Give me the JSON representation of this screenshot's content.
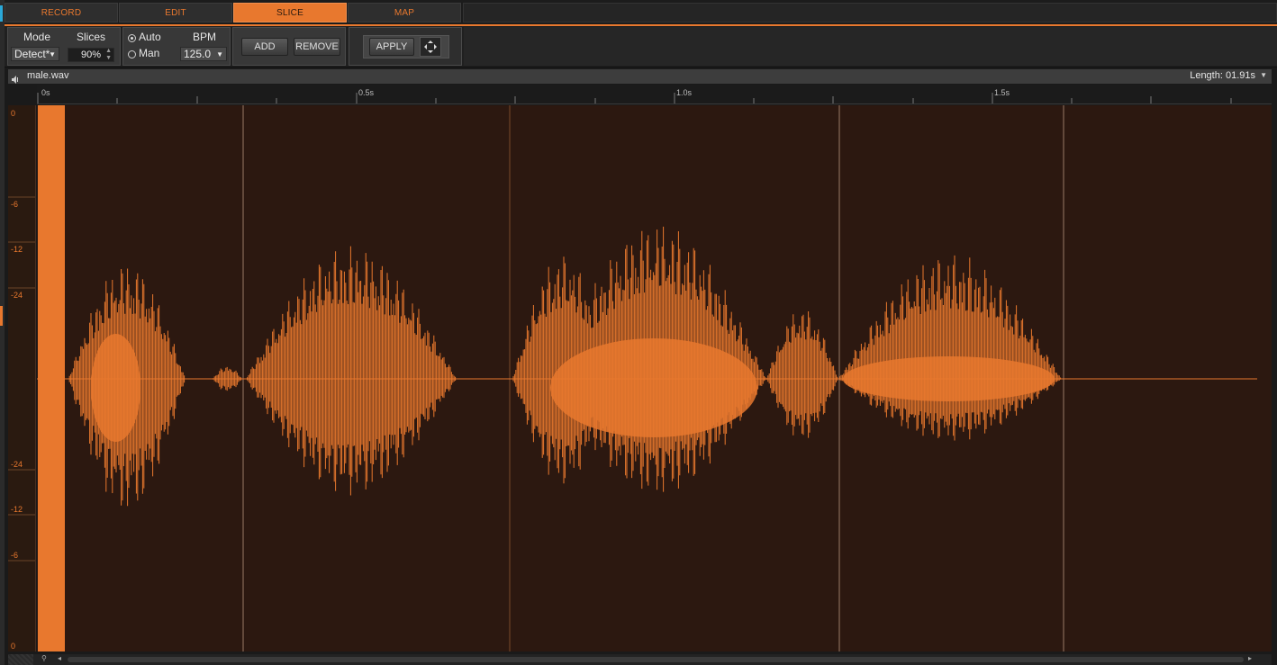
{
  "tabs": [
    {
      "label": "RECORD",
      "active": false
    },
    {
      "label": "EDIT",
      "active": false
    },
    {
      "label": "SLICE",
      "active": true
    },
    {
      "label": "MAP",
      "active": false
    }
  ],
  "toolbar": {
    "mode_label": "Mode",
    "mode_value": "Detect*",
    "slices_label": "Slices",
    "slices_value": "90%",
    "auto_label": "Auto",
    "man_label": "Man",
    "selected_radio": "Auto",
    "bpm_label": "BPM",
    "bpm_value": "125.0",
    "add_label": "ADD",
    "remove_label": "REMOVE",
    "apply_label": "APPLY",
    "move_icon": "move-arrows-icon"
  },
  "file": {
    "name": "male.wav",
    "length": "Length: 01.91s",
    "speaker_icon": "speaker-icon"
  },
  "ruler": {
    "labels": [
      "0s",
      "0.5s",
      "1.0s",
      "1.5s"
    ]
  },
  "db_scale": {
    "labels": [
      "0",
      "-6",
      "-12",
      "-24",
      "-24",
      "-12",
      "-6",
      "0"
    ]
  },
  "colors": {
    "accent": "#e8782e",
    "waveform_bg": "#2c1810"
  }
}
